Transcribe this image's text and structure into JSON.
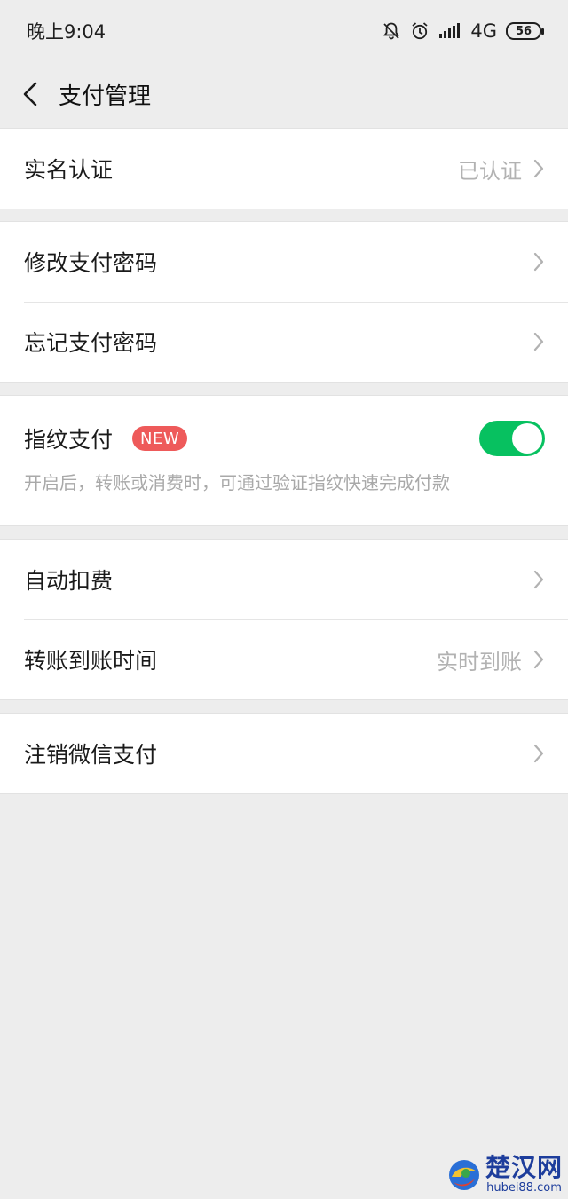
{
  "status_bar": {
    "time": "晚上9:04",
    "network": "4G",
    "battery": "56"
  },
  "nav": {
    "title": "支付管理"
  },
  "groups": {
    "identity": {
      "label": "实名认证",
      "value": "已认证"
    },
    "password": {
      "change_label": "修改支付密码",
      "forgot_label": "忘记支付密码"
    },
    "fingerprint": {
      "label": "指纹支付",
      "badge": "NEW",
      "enabled": true,
      "description": "开启后，转账或消费时，可通过验证指纹快速完成付款"
    },
    "payments": {
      "auto_deduct_label": "自动扣费",
      "transfer_time_label": "转账到账时间",
      "transfer_time_value": "实时到账"
    },
    "cancel": {
      "label": "注销微信支付"
    }
  },
  "watermark": {
    "name": "楚汉网",
    "url": "hubei88.com"
  },
  "colors": {
    "accent_green": "#07c160",
    "badge_red": "#ee5a5a",
    "background": "#ededed"
  }
}
